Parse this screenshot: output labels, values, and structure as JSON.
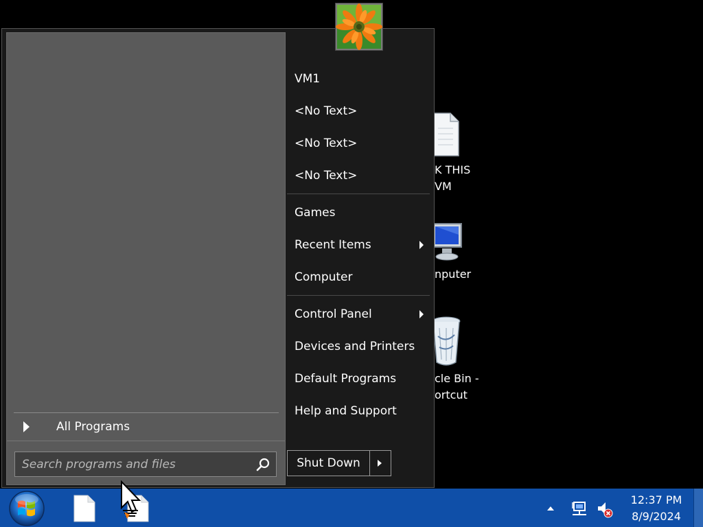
{
  "desktop": {
    "icons": [
      {
        "line1": "K THIS",
        "line2": "VM"
      },
      {
        "line1": "nputer"
      },
      {
        "line1": "cle Bin -",
        "line2": "ortcut"
      }
    ]
  },
  "start_menu": {
    "all_programs": "All Programs",
    "search_placeholder": "Search programs and files",
    "right_pane": {
      "user": "VM1",
      "items_group1": [
        "<No Text>",
        "<No Text>",
        "<No Text>"
      ],
      "items_group2": [
        "Games",
        "Recent Items",
        "Computer"
      ],
      "items_group3": [
        "Control Panel",
        "Devices and Printers",
        "Default Programs",
        "Help and Support"
      ]
    },
    "shutdown_label": "Shut Down"
  },
  "taskbar": {
    "time": "12:37 PM",
    "date": "8/9/2024"
  },
  "colors": {
    "taskbar": "#0f4fa8",
    "menu_bg": "#1a1a1a",
    "left_pane": "#5a5a5a"
  }
}
